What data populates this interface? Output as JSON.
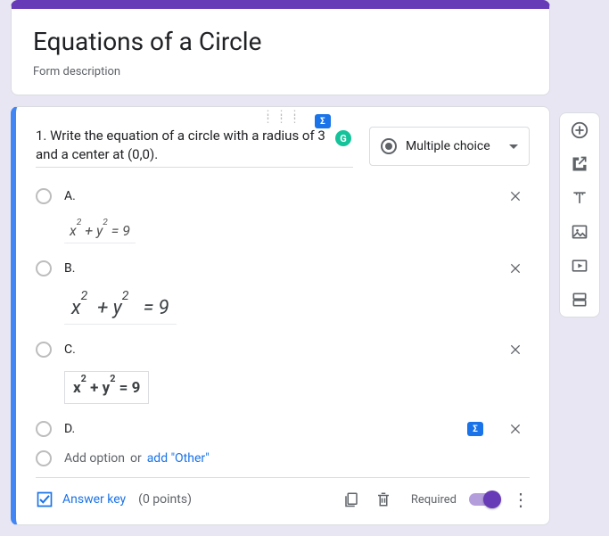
{
  "form": {
    "title": "Equations of a Circle",
    "description": "Form description"
  },
  "question": {
    "number_prefix": "1. ",
    "text": "Write the equation of a circle with a radius of 3 and a center at (0,0).",
    "type_label": "Multiple choice",
    "options": [
      {
        "label": "A."
      },
      {
        "label": "B."
      },
      {
        "label": "C."
      },
      {
        "label": "D."
      }
    ],
    "equations": {
      "a": "x² + y² = 9",
      "b": "x²  + y²   = 9",
      "c": "x² + y² = 9"
    },
    "add_option_label": "Add option",
    "add_or": "or",
    "add_other_label": "add \"Other\""
  },
  "footer": {
    "answer_key_label": "Answer key",
    "points_label": "(0 points)",
    "required_label": "Required",
    "required_on": true
  },
  "icons": {
    "sigma": "Σ"
  }
}
